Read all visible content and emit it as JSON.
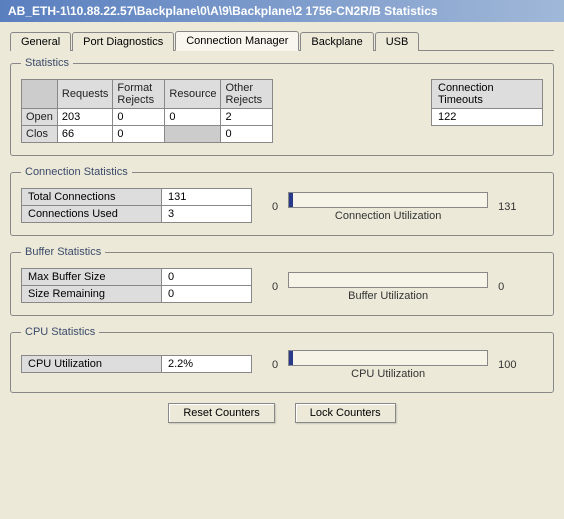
{
  "title": "AB_ETH-1\\10.88.22.57\\Backplane\\0\\A\\9\\Backplane\\2 1756-CN2R/B Statistics",
  "tabs": {
    "general": "General",
    "port_diag": "Port Diagnostics",
    "conn_mgr": "Connection Manager",
    "backplane": "Backplane",
    "usb": "USB"
  },
  "statistics": {
    "legend": "Statistics",
    "headers": {
      "requests": "Requests",
      "format_rejects": "Format Rejects",
      "resource": "Resource",
      "other_rejects": "Other Rejects"
    },
    "rows": {
      "open": {
        "label": "Open",
        "requests": "203",
        "format_rejects": "0",
        "resource": "0",
        "other_rejects": "2"
      },
      "clos": {
        "label": "Clos",
        "requests": "66",
        "format_rejects": "0",
        "resource": "",
        "other_rejects": "0"
      }
    },
    "timeouts_label": "Connection Timeouts",
    "timeouts_value": "122"
  },
  "conn_stats": {
    "legend": "Connection Statistics",
    "total_label": "Total Connections",
    "total_value": "131",
    "used_label": "Connections Used",
    "used_value": "3",
    "scale_min": "0",
    "scale_max": "131",
    "util_label": "Connection Utilization",
    "util_fill_pct": 2
  },
  "buffer_stats": {
    "legend": "Buffer Statistics",
    "max_label": "Max Buffer Size",
    "max_value": "0",
    "remain_label": "Size Remaining",
    "remain_value": "0",
    "scale_min": "0",
    "scale_max": "0",
    "util_label": "Buffer Utilization",
    "util_fill_pct": 0
  },
  "cpu_stats": {
    "legend": "CPU Statistics",
    "cpu_label": "CPU Utilization",
    "cpu_value": "2.2%",
    "scale_min": "0",
    "scale_max": "100",
    "util_label": "CPU Utilization",
    "util_fill_pct": 2
  },
  "buttons": {
    "reset": "Reset Counters",
    "lock": "Lock Counters"
  }
}
